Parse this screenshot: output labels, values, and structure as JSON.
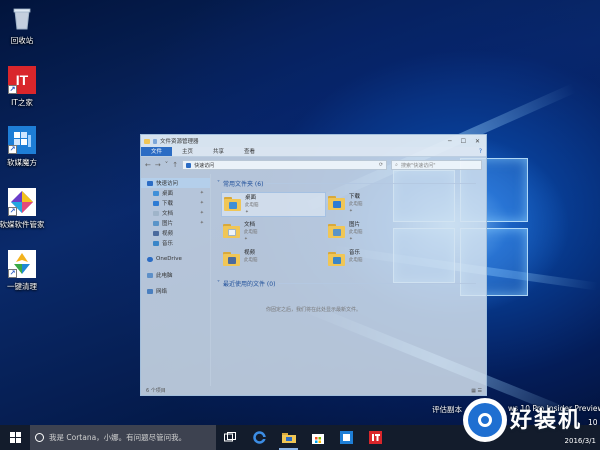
{
  "desktop_icons": [
    {
      "label": "回收站",
      "icon": "recycle-bin-icon"
    },
    {
      "label": "IT之家",
      "icon": "ithome-icon",
      "glyph": "IT"
    },
    {
      "label": "软媒魔方",
      "icon": "cube-icon"
    },
    {
      "label": "软媒软件管家",
      "icon": "software-manager-icon"
    },
    {
      "label": "一键清理",
      "icon": "cleanup-icon"
    }
  ],
  "explorer": {
    "title": "文件资源管理器",
    "tabs": [
      "文件",
      "主页",
      "共享",
      "查看"
    ],
    "address": "快速访问",
    "search_placeholder": "搜索\"快速访问\"",
    "nav": {
      "quick_access": "快速访问",
      "items": [
        "桌面",
        "下载",
        "文档",
        "图片",
        "视频",
        "音乐"
      ],
      "onedrive": "OneDrive",
      "this_pc": "此电脑",
      "network": "网络"
    },
    "frequent_header": "常用文件夹 (6)",
    "folders": [
      {
        "name": "桌面",
        "location": "此电脑"
      },
      {
        "name": "下载",
        "location": "此电脑"
      },
      {
        "name": "文档",
        "location": "此电脑"
      },
      {
        "name": "图片",
        "location": "此电脑"
      },
      {
        "name": "视频",
        "location": "此电脑"
      },
      {
        "name": "音乐",
        "location": "此电脑"
      }
    ],
    "recent_header": "最近使用的文件 (0)",
    "empty_message": "你固定之后，我们将在此处显示最新文件。",
    "status": "6 个项目"
  },
  "taskbar": {
    "cortana_placeholder": "我是 Cortana，小娜。有问题尽管问我。",
    "date": "2016/3/1",
    "apps": [
      "task-view-icon",
      "edge-icon",
      "file-explorer-icon",
      "store-icon",
      "cube-app-icon",
      "ithome-app-icon"
    ]
  },
  "watermark": {
    "line1": "评估副本",
    "line1_right": "ws 10 Pro Insider Preview",
    "line2_right": "10",
    "brand": "好装机"
  },
  "colors": {
    "accent": "#2b6cc4",
    "taskbar": "#131c2c",
    "folder": "#f0c656"
  }
}
